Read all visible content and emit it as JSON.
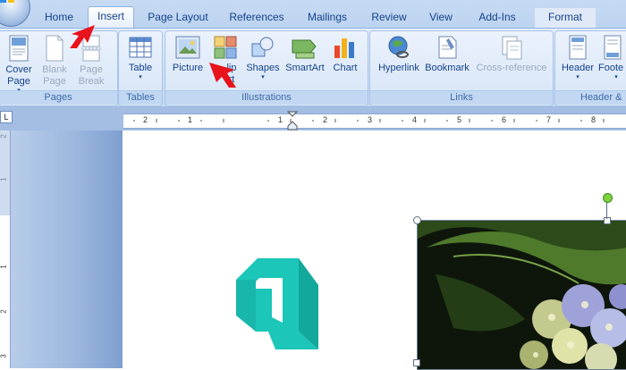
{
  "tabs": [
    {
      "label": "Home"
    },
    {
      "label": "Insert",
      "active": true
    },
    {
      "label": "Page Layout"
    },
    {
      "label": "References"
    },
    {
      "label": "Mailings"
    },
    {
      "label": "Review"
    },
    {
      "label": "View"
    },
    {
      "label": "Add-Ins"
    },
    {
      "label": "Format"
    }
  ],
  "groups": {
    "pages": {
      "label": "Pages",
      "cover_page": {
        "line1": "Cover",
        "line2": "Page",
        "dropdown": "▾"
      },
      "blank_page": {
        "line1": "Blank",
        "line2": "Page"
      },
      "page_break": {
        "line1": "Page",
        "line2": "Break"
      }
    },
    "tables": {
      "label": "Tables",
      "table": {
        "line1": "Table",
        "dropdown": "▾"
      }
    },
    "illustrations": {
      "label": "Illustrations",
      "picture": "Picture",
      "clip_art": {
        "line1": "lip",
        "line2": "rt"
      },
      "shapes": {
        "line1": "Shapes",
        "dropdown": "▾"
      },
      "smartart": "SmartArt",
      "chart": "Chart"
    },
    "links": {
      "label": "Links",
      "hyperlink": "Hyperlink",
      "bookmark": "Bookmark",
      "cross_reference": "Cross-reference"
    },
    "header_footer": {
      "label": "Header &",
      "header": {
        "line1": "Header",
        "dropdown": "▾"
      },
      "footer": {
        "line1": "Foote",
        "dropdown": "▾"
      }
    }
  },
  "ruler": {
    "tab_selector": "L",
    "numbers": [
      "2",
      "1",
      "1",
      "2",
      "3",
      "4",
      "5",
      "6",
      "7",
      "8"
    ]
  },
  "vruler": {
    "numbers": [
      "2",
      "1",
      "1",
      "2",
      "3"
    ]
  },
  "colors": {
    "logo_teal": "#1cc6b8",
    "logo_teal_dark": "#13a89c",
    "annotation_red": "#e8131b",
    "rotation_handle": "#7ed23d"
  },
  "icons": {
    "office_button": "office-logo-icon",
    "annotation_arrow": "red-arrow-icon",
    "document_logo": "teal-a-logo"
  }
}
